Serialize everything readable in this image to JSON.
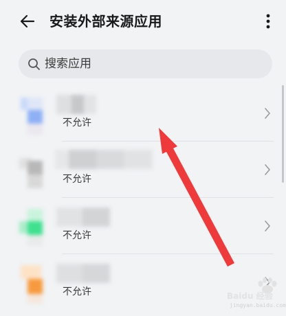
{
  "header": {
    "title": "安装外部来源应用",
    "back_icon": "back-arrow-icon",
    "more_icon": "more-vertical-icon"
  },
  "search": {
    "placeholder": "搜索应用",
    "value": "",
    "icon": "search-icon"
  },
  "apps": [
    {
      "status": "不允许",
      "accent": "#8fb0f5"
    },
    {
      "status": "不允许",
      "accent": "#b8b8b8"
    },
    {
      "status": "不允许",
      "accent": "#3fe08e"
    },
    {
      "status": "不允许",
      "accent": "#f79a3e"
    }
  ],
  "colors": {
    "background": "#f1f3f5",
    "search_bg": "#e6e8eb",
    "annotation_arrow": "#ee3a3a"
  },
  "watermark": {
    "brand": "Baidu 经验",
    "url": "jingyan.baidu.com"
  }
}
